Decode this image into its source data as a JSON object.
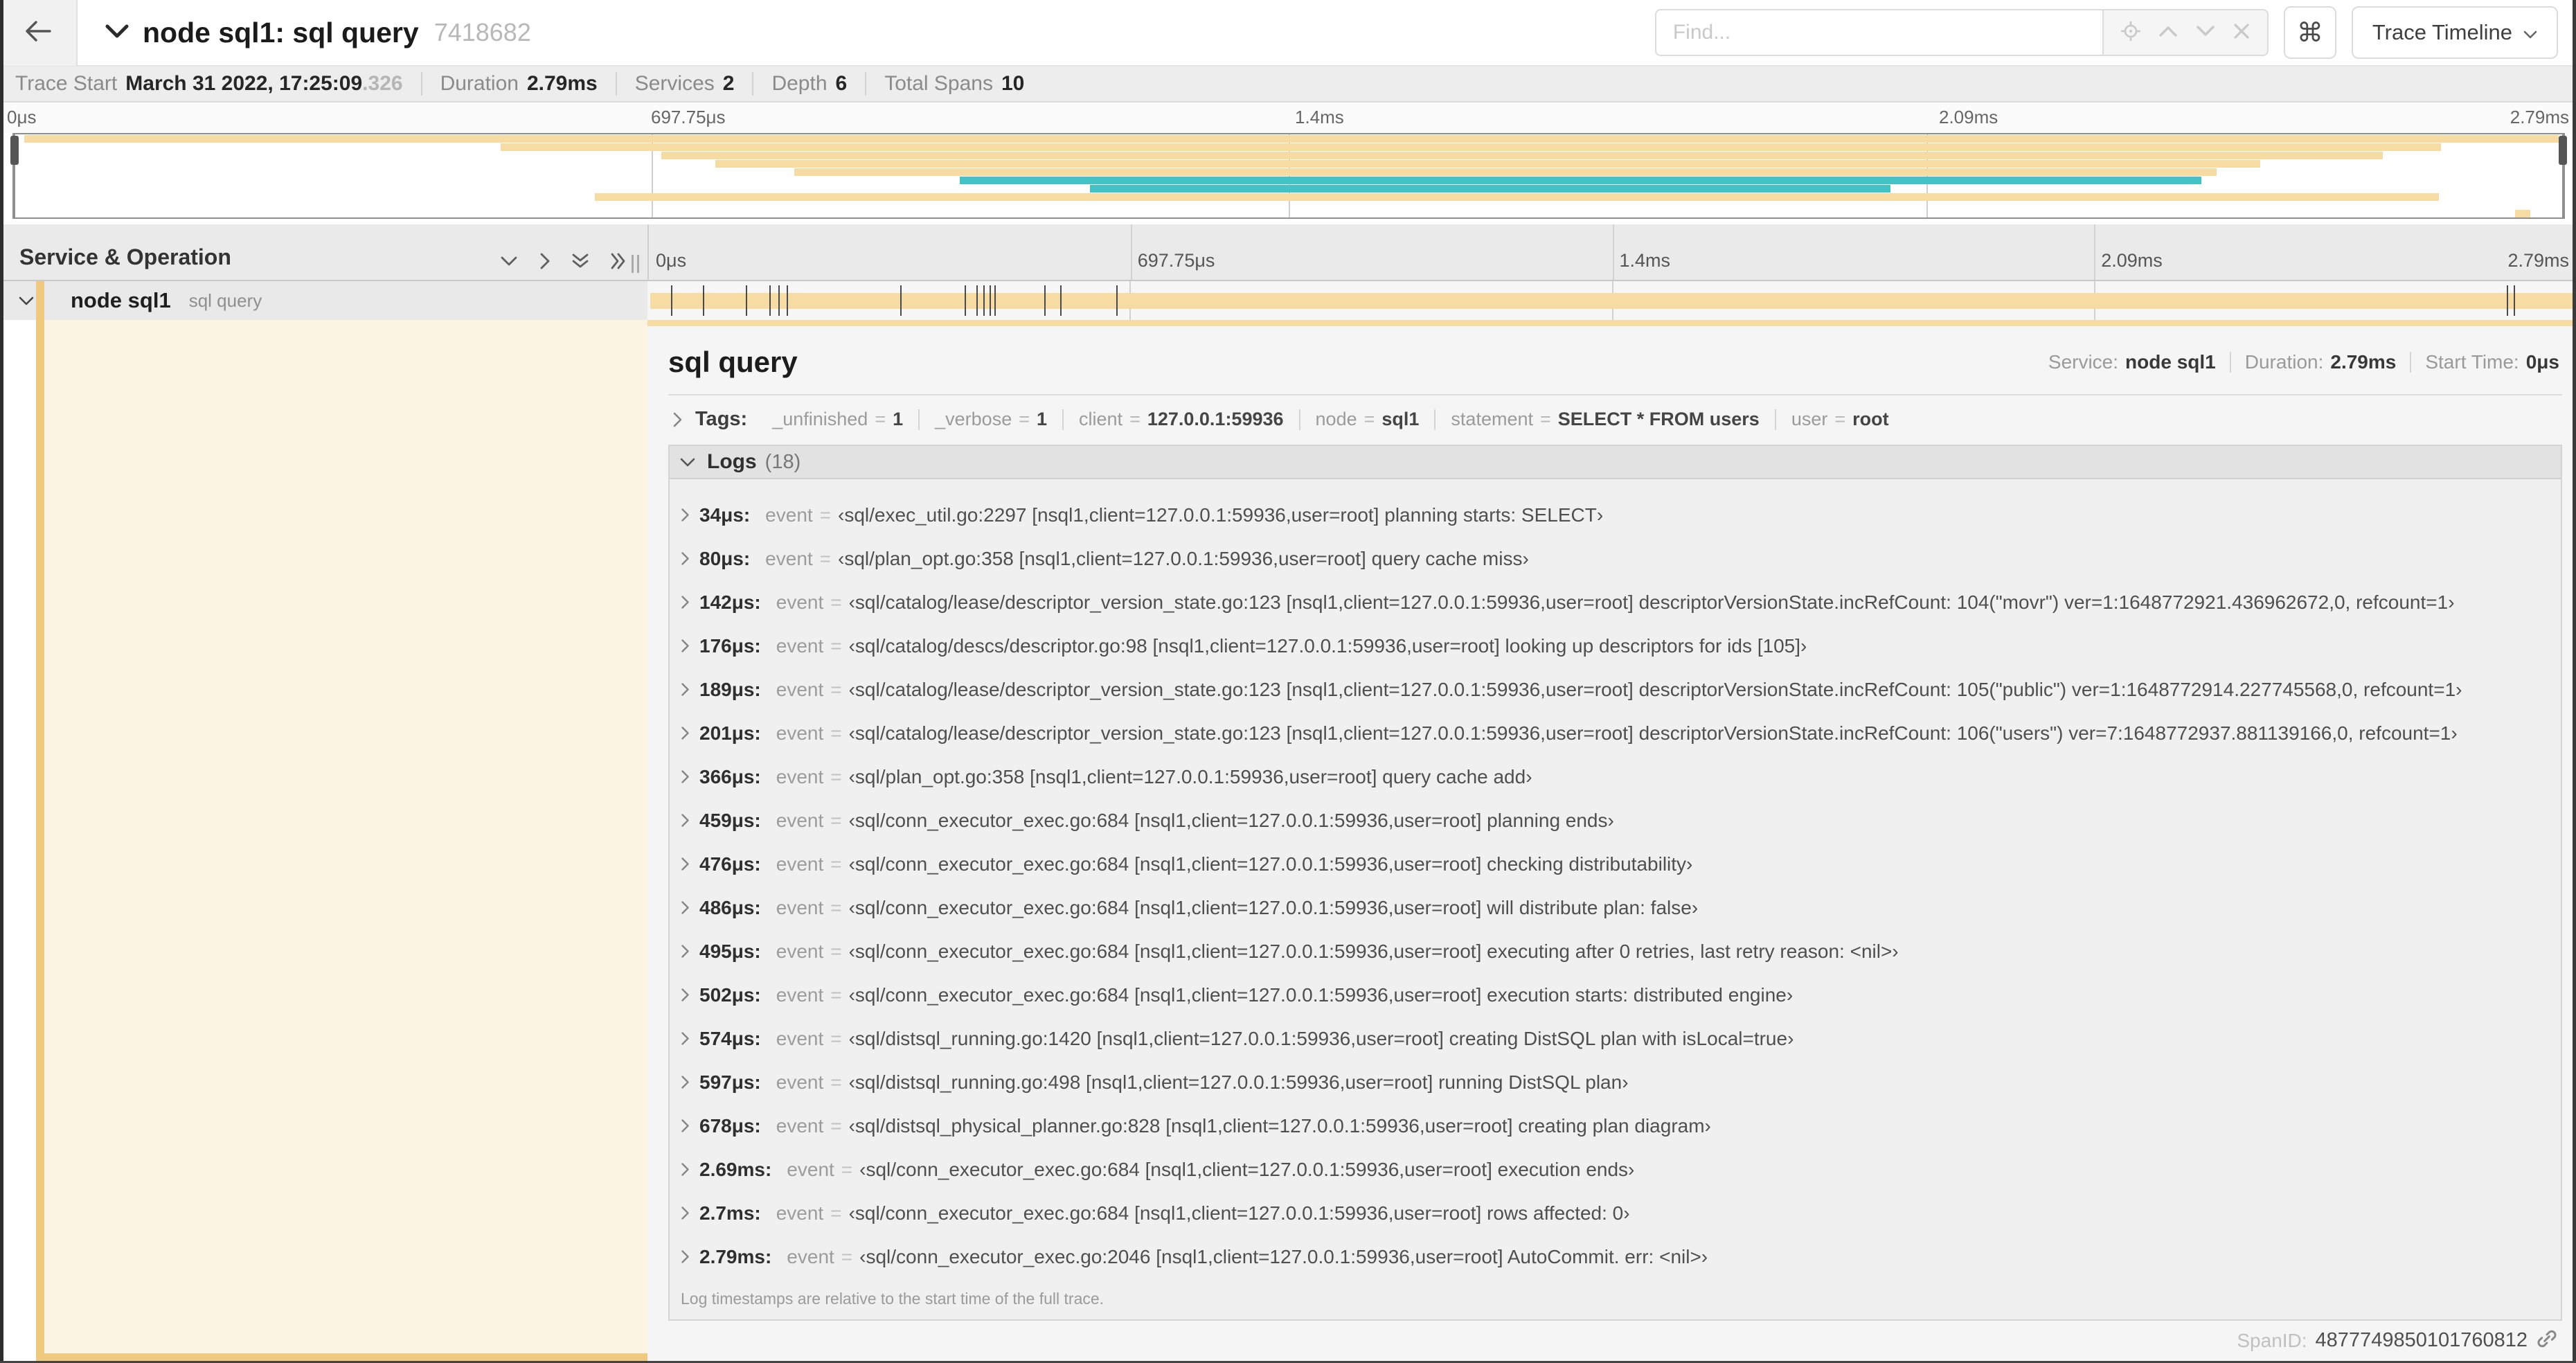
{
  "colors": {
    "tan": "#F6DBA2",
    "tanStrip": "#EFC97E",
    "teal": "#44C2C6",
    "cream": "#FBF4E2",
    "barTick": "#4a4a4a"
  },
  "header": {
    "title": "node sql1: sql query",
    "trace_id": "7418682",
    "find_placeholder": "Find...",
    "shortcut_label": "⌘",
    "view_select_label": "Trace Timeline"
  },
  "trace_info": {
    "items": [
      {
        "label": "Trace Start",
        "value": "March 31 2022, 17:25:09",
        "suffix": ".326"
      },
      {
        "label": "Duration",
        "value": "2.79ms"
      },
      {
        "label": "Services",
        "value": "2"
      },
      {
        "label": "Depth",
        "value": "6"
      },
      {
        "label": "Total Spans",
        "value": "10"
      }
    ]
  },
  "timeline": {
    "duration_us": 2790,
    "ticks": [
      {
        "label": "0μs",
        "pct": 0
      },
      {
        "label": "697.75μs",
        "pct": 25
      },
      {
        "label": "1.4ms",
        "pct": 50
      },
      {
        "label": "2.09ms",
        "pct": 75
      },
      {
        "label": "2.79ms",
        "pct": 100
      }
    ],
    "viewport_lines": [
      25,
      50,
      75
    ]
  },
  "minimap": {
    "rows": [
      {
        "r": 0,
        "s": 0.004,
        "e": 0.998,
        "c": "tan"
      },
      {
        "r": 1,
        "s": 0.191,
        "e": 0.952,
        "c": "tan"
      },
      {
        "r": 2,
        "s": 0.254,
        "e": 0.929,
        "c": "tan"
      },
      {
        "r": 3,
        "s": 0.275,
        "e": 0.881,
        "c": "tan"
      },
      {
        "r": 4,
        "s": 0.306,
        "e": 0.864,
        "c": "tan"
      },
      {
        "r": 5,
        "s": 0.371,
        "e": 0.858,
        "c": "teal"
      },
      {
        "r": 6,
        "s": 0.422,
        "e": 0.736,
        "c": "teal"
      },
      {
        "r": 7,
        "s": 0.228,
        "e": 0.951,
        "c": "tan"
      },
      {
        "r": 9,
        "s": 0.981,
        "e": 0.987,
        "c": "tan"
      }
    ]
  },
  "span_table": {
    "header_label": "Service & Operation",
    "row": {
      "service": "node sql1",
      "operation": "sql query"
    },
    "bar_ticks_us": [
      34,
      80,
      142,
      176,
      189,
      201,
      366,
      459,
      476,
      486,
      495,
      502,
      574,
      597,
      678,
      2690,
      2700
    ]
  },
  "detail": {
    "title": "sql query",
    "meta": [
      {
        "label": "Service:",
        "value": "node sql1"
      },
      {
        "label": "Duration:",
        "value": "2.79ms"
      },
      {
        "label": "Start Time:",
        "value": "0μs"
      }
    ],
    "tags": {
      "label": "Tags:",
      "eq": "=",
      "items": [
        {
          "k": "_unfinished",
          "v": "1"
        },
        {
          "k": "_verbose",
          "v": "1"
        },
        {
          "k": "client",
          "v": "127.0.0.1:59936"
        },
        {
          "k": "node",
          "v": "sql1"
        },
        {
          "k": "statement",
          "v": "SELECT * FROM users"
        },
        {
          "k": "user",
          "v": "root"
        }
      ]
    },
    "logs": {
      "label": "Logs",
      "count": "(18)",
      "key": "event",
      "eq": "=",
      "entries": [
        {
          "t": "34μs:",
          "v": "‹sql/exec_util.go:2297 [nsql1,client=127.0.0.1:59936,user=root] planning starts: SELECT›"
        },
        {
          "t": "80μs:",
          "v": "‹sql/plan_opt.go:358 [nsql1,client=127.0.0.1:59936,user=root] query cache miss›"
        },
        {
          "t": "142μs:",
          "v": "‹sql/catalog/lease/descriptor_version_state.go:123 [nsql1,client=127.0.0.1:59936,user=root] descriptorVersionState.incRefCount: 104(\"movr\") ver=1:1648772921.436962672,0, refcount=1›"
        },
        {
          "t": "176μs:",
          "v": "‹sql/catalog/descs/descriptor.go:98 [nsql1,client=127.0.0.1:59936,user=root] looking up descriptors for ids [105]›"
        },
        {
          "t": "189μs:",
          "v": "‹sql/catalog/lease/descriptor_version_state.go:123 [nsql1,client=127.0.0.1:59936,user=root] descriptorVersionState.incRefCount: 105(\"public\") ver=1:1648772914.227745568,0, refcount=1›"
        },
        {
          "t": "201μs:",
          "v": "‹sql/catalog/lease/descriptor_version_state.go:123 [nsql1,client=127.0.0.1:59936,user=root] descriptorVersionState.incRefCount: 106(\"users\") ver=7:1648772937.881139166,0, refcount=1›"
        },
        {
          "t": "366μs:",
          "v": "‹sql/plan_opt.go:358 [nsql1,client=127.0.0.1:59936,user=root] query cache add›"
        },
        {
          "t": "459μs:",
          "v": "‹sql/conn_executor_exec.go:684 [nsql1,client=127.0.0.1:59936,user=root] planning ends›"
        },
        {
          "t": "476μs:",
          "v": "‹sql/conn_executor_exec.go:684 [nsql1,client=127.0.0.1:59936,user=root] checking distributability›"
        },
        {
          "t": "486μs:",
          "v": "‹sql/conn_executor_exec.go:684 [nsql1,client=127.0.0.1:59936,user=root] will distribute plan: false›"
        },
        {
          "t": "495μs:",
          "v": "‹sql/conn_executor_exec.go:684 [nsql1,client=127.0.0.1:59936,user=root] executing after 0 retries, last retry reason: <nil>›"
        },
        {
          "t": "502μs:",
          "v": "‹sql/conn_executor_exec.go:684 [nsql1,client=127.0.0.1:59936,user=root] execution starts: distributed engine›"
        },
        {
          "t": "574μs:",
          "v": "‹sql/distsql_running.go:1420 [nsql1,client=127.0.0.1:59936,user=root] creating DistSQL plan with isLocal=true›"
        },
        {
          "t": "597μs:",
          "v": "‹sql/distsql_running.go:498 [nsql1,client=127.0.0.1:59936,user=root] running DistSQL plan›"
        },
        {
          "t": "678μs:",
          "v": "‹sql/distsql_physical_planner.go:828 [nsql1,client=127.0.0.1:59936,user=root] creating plan diagram›"
        },
        {
          "t": "2.69ms:",
          "v": "‹sql/conn_executor_exec.go:684 [nsql1,client=127.0.0.1:59936,user=root] execution ends›"
        },
        {
          "t": "2.7ms:",
          "v": "‹sql/conn_executor_exec.go:684 [nsql1,client=127.0.0.1:59936,user=root] rows affected: 0›"
        },
        {
          "t": "2.79ms:",
          "v": "‹sql/conn_executor_exec.go:2046 [nsql1,client=127.0.0.1:59936,user=root] AutoCommit. err: <nil>›"
        }
      ],
      "note": "Log timestamps are relative to the start time of the full trace."
    },
    "footer": {
      "label": "SpanID:",
      "value": "4877749850101760812"
    }
  }
}
